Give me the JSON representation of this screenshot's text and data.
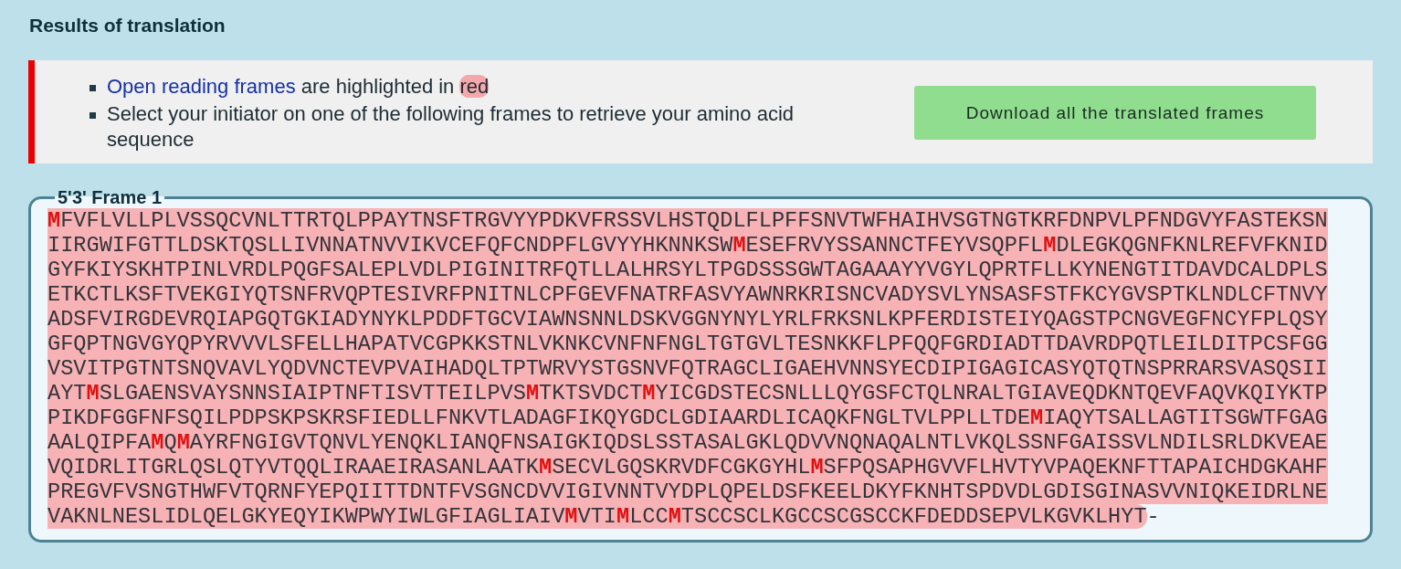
{
  "title": "Results of translation",
  "notice": {
    "items": [
      {
        "kind": "legend",
        "link": "Open reading frames",
        "text": " are highlighted in ",
        "highlight": "red"
      },
      {
        "kind": "plain",
        "text": "Select your initiator on one of the following frames to retrieve your amino acid sequence"
      }
    ],
    "download_button": "Download all the translated frames"
  },
  "frames": [
    {
      "title": "5'3' Frame 1",
      "orf_lines": [
        "**M**FVFLVLLPLVSSQCVNLTTRTQLPPAYTNSFTRGVYYPDKVFRSSVLHSTQDLFLPFFSNVTWFHAIHVSGTNGTKRFDNPVLPFNDGVYFASTEKSN",
        "IIRGWIFGTTLDSKTQSLLIVNNATNVVIKVCEFQFCNDPFLGVYYHKNNKSW**M**ESEFRVYSSANNCTFEYVSQPFL**M**DLEGKQGNFKNLREFVFKNID",
        "GYFKIYSKHTPINLVRDLPQGFSALEPLVDLPIGINITRFQTLLALHRSYLTPGDSSSGWTAGAAAYYVGYLQPRTFLLKYNENGTITDAVDCALDPLS",
        "ETKCTLKSFTVEKGIYQTSNFRVQPTESIVRFPNITNLCPFGEVFNATRFASVYAWNRKRISNCVADYSVLYNSASFSTFKCYGVSPTKLNDLCFTNVY",
        "ADSFVIRGDEVRQIAPGQTGKIADYNYKLPDDFTGCVIAWNSNNLDSKVGGNYNYLYRLFRKSNLKPFERDISTEIYQAGSTPCNGVEGFNCYFPLQSY",
        "GFQPTNGVGYQPYRVVVLSFELLHAPATVCGPKKSTNLVKNKCVNFNFNGLTGTGVLTESNKKFLPFQQFGRDIADTTDAVRDPQTLEILDITPCSFGG",
        "VSVITPGTNTSNQVAVLYQDVNCTEVPVAIHADQLTPTWRVYSTGSNVFQTRAGCLIGAEHVNNSYECDIPIGAGICASYQTQTNSPRRARSVASQSII",
        "AYT**M**SLGAENSVAYSNNSIAIPTNFTISVTTEILPVS**M**TKTSVDCT**M**YICGDSTECSNLLLQYGSFCTQLNRALTGIAVEQDKNTQEVFAQVKQIYKTP",
        "PIKDFGGFNFSQILPDPSKPSKRSFIEDLLFNKVTLADAGFIKQYGDCLGDIAARDLICAQKFNGLTVLPPLLTDE**M**IAQYTSALLAGTITSGWTFGAG",
        "AALQIPFA**M**Q**M**AYRFNGIGVTQNVLYENQKLIANQFNSAIGKIQDSLSSTASALGKLQDVVNQNAQALNTLVKQLSSNFGAISSVLNDILSRLDKVEAE",
        "VQIDRLITGRLQSLQTYVTQQLIRAAEIRASANLAATK**M**SECVLGQSKRVDFCGKGYHL**M**SFPQSAPHGVVFLHVTYVPAQEKNFTTAPAICHDGKAHF",
        "PREGVFVSNGTHWFVTQRNFYEPQIITTDNTFVSGNCDVVIGIVNNTVYDPLQPELDSFKEELDKYFKNHTSPDVDLGDISGINASVVNIQKEIDRLNE",
        "VAKNLNESLIDLQELGKYEQYIKWPWYIWLGFIAGLIAIV**M**VTI**M**LCC**M**TSCCSCLKGCCSCGSCCKFDEDDSEPVLKGVKLHYT"
      ],
      "after_orf": "-"
    }
  ]
}
